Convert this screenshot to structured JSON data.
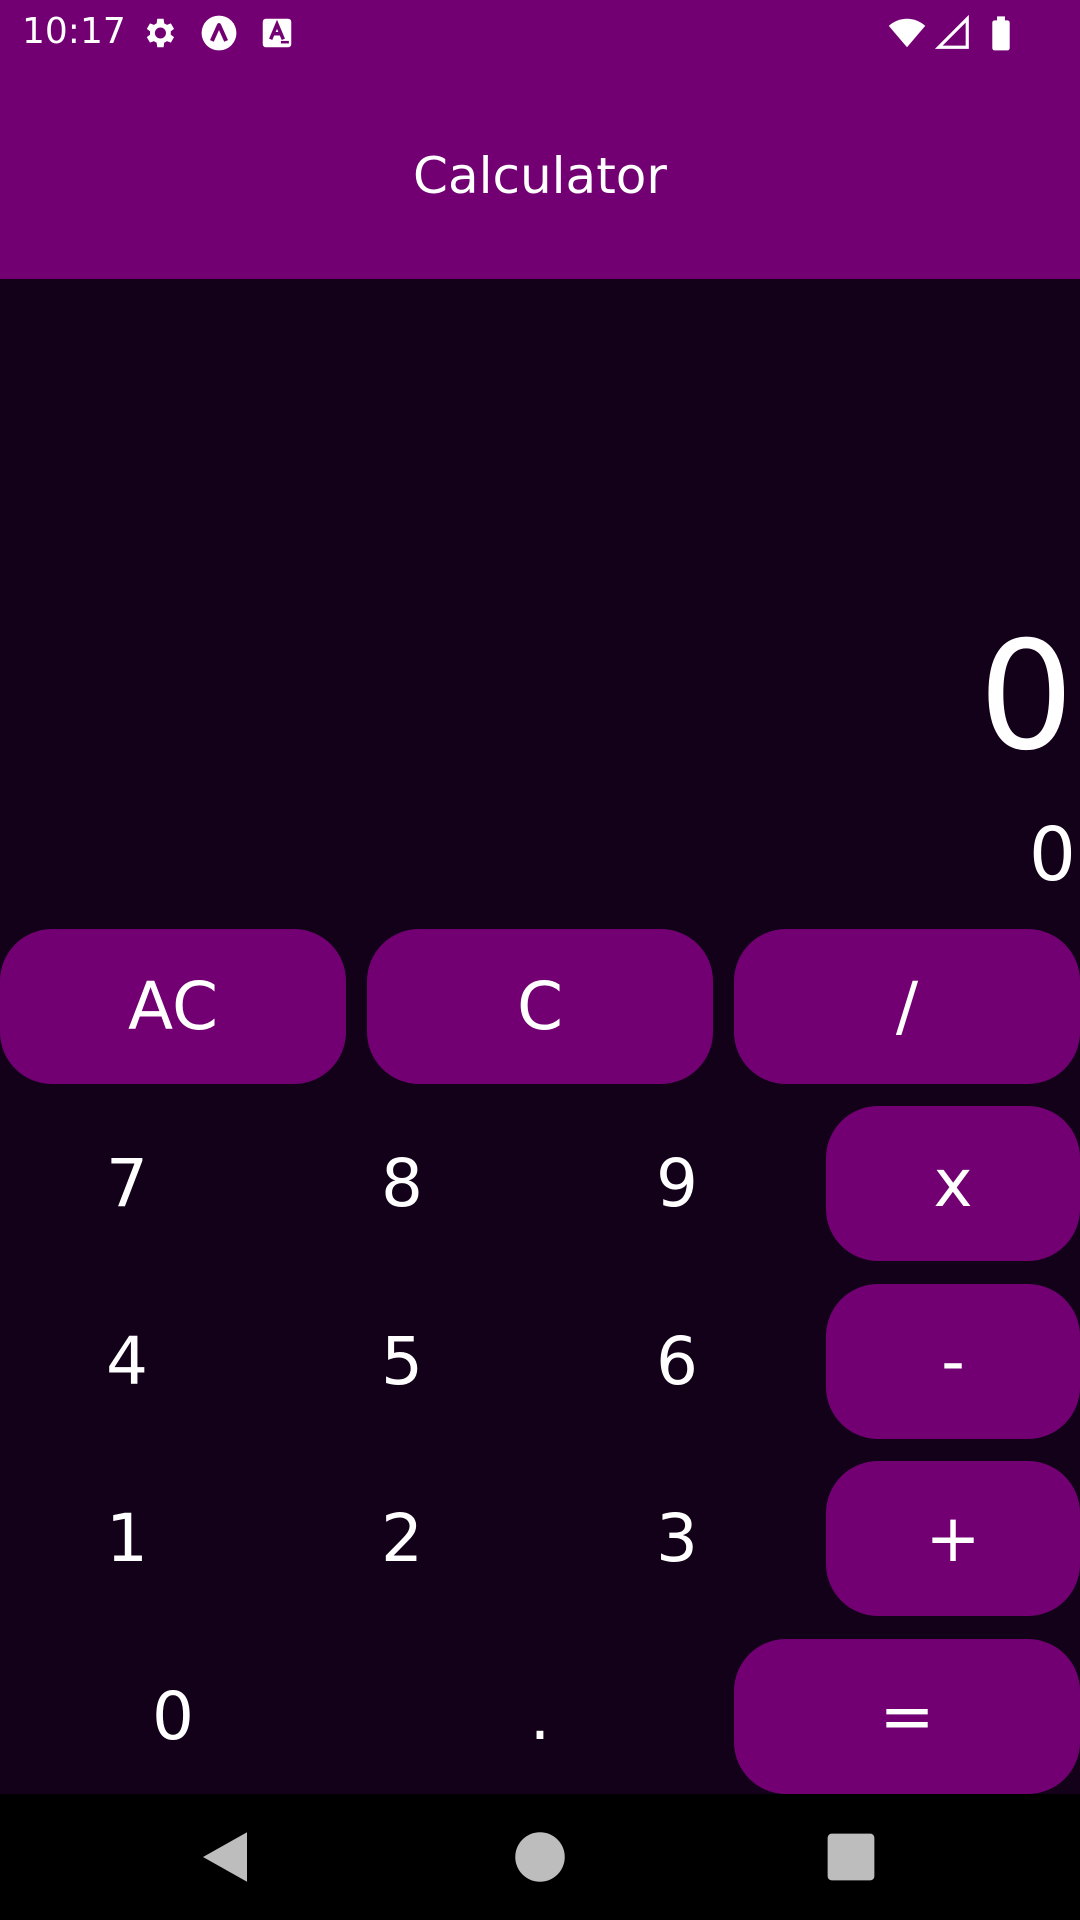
{
  "status_bar": {
    "time": "10:17",
    "icons": [
      "gear-icon",
      "app-a-icon",
      "font-a-icon",
      "wifi-icon",
      "signal-icon",
      "battery-icon"
    ]
  },
  "app_bar": {
    "title": "Calculator"
  },
  "display": {
    "main_value": "0",
    "secondary_value": "0"
  },
  "keypad": {
    "ac": "AC",
    "c": "C",
    "divide": "/",
    "multiply": "x",
    "subtract": "-",
    "add": "+",
    "equals": "=",
    "seven": "7",
    "eight": "8",
    "nine": "9",
    "four": "4",
    "five": "5",
    "six": "6",
    "one": "1",
    "two": "2",
    "three": "3",
    "zero": "0",
    "decimal": "."
  },
  "nav_bar": {
    "icons": [
      "back-icon",
      "home-icon",
      "recents-icon"
    ]
  },
  "colors": {
    "accent": "#730073",
    "background": "#130019",
    "text": "#ffffff"
  }
}
